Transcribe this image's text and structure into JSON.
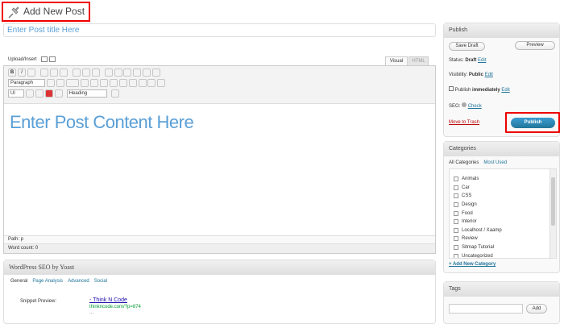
{
  "page": {
    "title": "Add New Post"
  },
  "post": {
    "title_placeholder": "Enter Post title Here",
    "content_placeholder": "Enter Post Content Here"
  },
  "editor": {
    "upload_insert": "Upload/Insert",
    "tab_visual": "Visual",
    "tab_html": "HTML",
    "format_select": "Paragraph",
    "ul_select": "Ul",
    "heading_select": "Heading",
    "path": "Path: p",
    "word_count": "Word count: 0"
  },
  "publish": {
    "title": "Publish",
    "save_draft": "Save Draft",
    "preview": "Preview",
    "status_label": "Status:",
    "status_value": "Draft",
    "visibility_label": "Visibility:",
    "visibility_value": "Public",
    "publish_label": "Publish",
    "publish_value": "immediately",
    "edit": "Edit",
    "seo_label": "SEO:",
    "check": "Check",
    "move_trash": "Move to Trash",
    "publish_button": "Publish"
  },
  "categories": {
    "title": "Categories",
    "tab_all": "All Categories",
    "tab_most": "Most Used",
    "items": [
      "Animals",
      "Car",
      "CSS",
      "Design",
      "Food",
      "Interior",
      "Localhost / Xaamp",
      "Review",
      "Sitmap Tutorial",
      "Uncategorized"
    ],
    "add_new": "+ Add New Category"
  },
  "tags": {
    "title": "Tags",
    "add": "Add"
  },
  "seo": {
    "title": "WordPress SEO by Yoast",
    "tabs": [
      "General",
      "Page Analysis",
      "Advanced",
      "Social"
    ],
    "snippet_label": "Snippet Preview:",
    "snippet_title": "- Think N Code",
    "snippet_url": "thinkncode.com/?p=874",
    "snippet_desc": "..."
  },
  "colors": {
    "link": "#21759b",
    "highlight": "#e00000",
    "publish_button": "#2a8bb8"
  }
}
